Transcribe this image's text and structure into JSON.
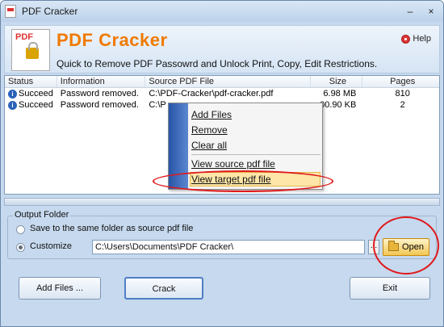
{
  "window": {
    "title": "PDF Cracker",
    "minimize": "–",
    "close": "×"
  },
  "header": {
    "brand": "PDF Cracker",
    "logo_text": "PDF",
    "tagline": "Quick to Remove PDF  Passowrd and Unlock Print, Copy, Edit Restrictions.",
    "help_label": "Help"
  },
  "table": {
    "columns": [
      "Status",
      "Information",
      "Source PDF File",
      "Size",
      "Pages"
    ],
    "rows": [
      {
        "status": "Succeed",
        "info": "Password removed.",
        "source": "C:\\PDF-Cracker\\pdf-cracker.pdf",
        "size": "6.98 MB",
        "pages": "810"
      },
      {
        "status": "Succeed",
        "info": "Password removed.",
        "source": "C:\\P",
        "size": "00.90 KB",
        "pages": "2"
      }
    ]
  },
  "context_menu": {
    "items": [
      "Add Files",
      "Remove",
      "Clear all",
      "View source pdf file",
      "View target pdf file"
    ]
  },
  "output": {
    "group_label": "Output Folder",
    "option_same": "Save to the same folder as source pdf file",
    "option_custom": "Customize",
    "path": "C:\\Users\\Documents\\PDF Cracker\\",
    "browse_label": "...",
    "open_label": "Open"
  },
  "buttons": {
    "add_files": "Add Files ...",
    "crack": "Crack",
    "exit": "Exit"
  },
  "colors": {
    "brand": "#f07a00",
    "annotation_ring": "#e0191b",
    "window_bg": "#c6d9ee"
  }
}
